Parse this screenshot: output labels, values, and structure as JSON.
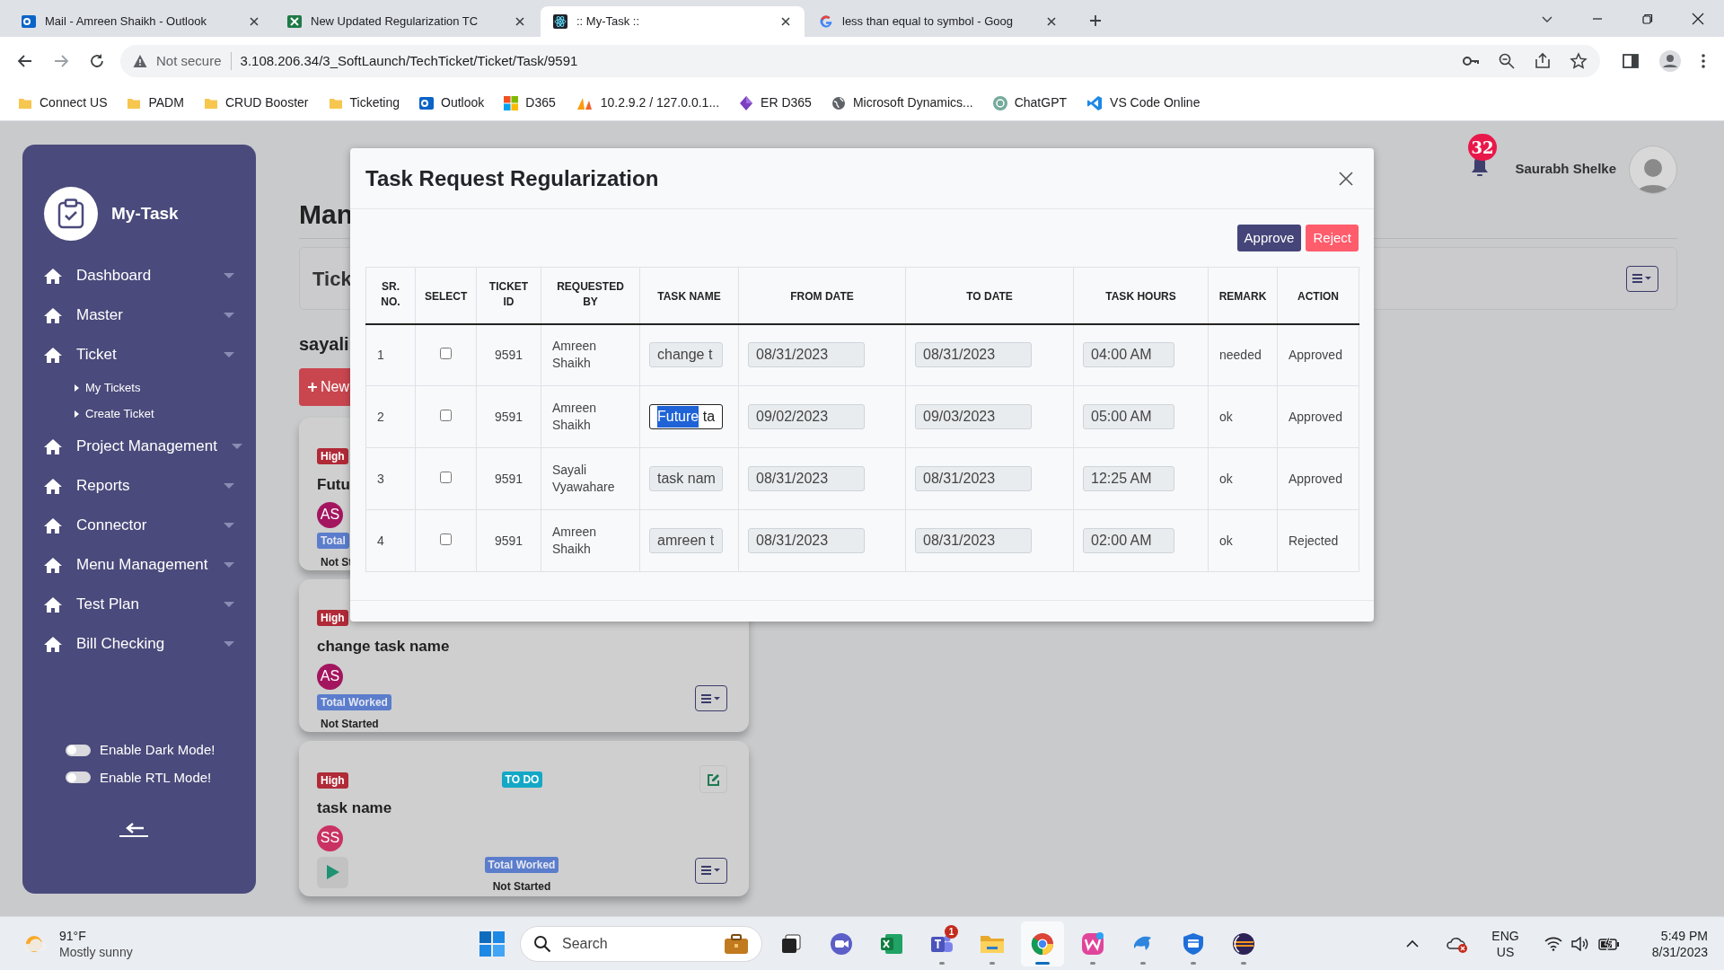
{
  "browser": {
    "tabs": [
      {
        "kind": "outlook",
        "title": "Mail - Amreen Shaikh - Outlook",
        "selected": false
      },
      {
        "kind": "excel",
        "title": "New Updated Regularization TC",
        "selected": false
      },
      {
        "kind": "react",
        "title": ":: My-Task ::",
        "selected": true
      },
      {
        "kind": "google",
        "title": "less than equal to symbol - Goog",
        "selected": false
      }
    ],
    "address_bar": {
      "security": "Not secure",
      "url": "3.108.206.34/3_SoftLaunch/TechTicket/Ticket/Task/9591"
    },
    "bookmarks": [
      {
        "kind": "folder",
        "label": "Connect US"
      },
      {
        "kind": "folder",
        "label": "PADM"
      },
      {
        "kind": "folder",
        "label": "CRUD Booster"
      },
      {
        "kind": "folder",
        "label": "Ticketing"
      },
      {
        "kind": "outlook",
        "label": "Outlook"
      },
      {
        "kind": "windows",
        "label": "D365"
      },
      {
        "kind": "pma",
        "label": "10.2.9.2 / 127.0.0.1..."
      },
      {
        "kind": "diamond",
        "label": "ER D365"
      },
      {
        "kind": "globe",
        "label": "Microsoft Dynamics..."
      },
      {
        "kind": "chatgpt",
        "label": "ChatGPT"
      },
      {
        "kind": "vscode",
        "label": "VS Code Online"
      }
    ]
  },
  "sidebar": {
    "app_name": "My-Task",
    "menu": [
      {
        "label": "Dashboard"
      },
      {
        "label": "Master"
      },
      {
        "label": "Ticket",
        "children": [
          {
            "label": "My Tickets"
          },
          {
            "label": "Create Ticket"
          }
        ]
      },
      {
        "label": "Project Management"
      },
      {
        "label": "Reports"
      },
      {
        "label": "Connector"
      },
      {
        "label": "Menu Management"
      },
      {
        "label": "Test Plan"
      },
      {
        "label": "Bill Checking"
      }
    ],
    "toggles": [
      {
        "label": "Enable Dark Mode!",
        "on": false
      },
      {
        "label": "Enable RTL Mode!",
        "on": false
      }
    ]
  },
  "header": {
    "notifications": "32",
    "user_name": "Saurabh Shelke"
  },
  "page": {
    "heading": "Man",
    "filter_card": {
      "label": "Tick"
    },
    "section": "sayali",
    "new_button": "New",
    "cards": [
      {
        "kind": "partial",
        "priority": "High",
        "title": "Futu",
        "initials": "AS",
        "color": "#a3165f",
        "total_label": "Total",
        "time": "Not St"
      },
      {
        "kind": "task",
        "priority": "High",
        "title": "change task name",
        "initials": "AS",
        "color": "#a3165f",
        "total_label": "Total Worked",
        "time": "Not Started"
      },
      {
        "kind": "todo",
        "priority": "High",
        "status": "TO DO",
        "title": "task name",
        "initials": "SS",
        "color": "#c93263",
        "total_label": "Total Worked",
        "time": "Not Started"
      }
    ]
  },
  "modal": {
    "title": "Task Request Regularization",
    "buttons": [
      {
        "kind": "approve",
        "label": "Approve"
      },
      {
        "kind": "reject",
        "label": "Reject"
      }
    ],
    "columns": [
      "SR. NO.",
      "SELECT",
      "TICKET ID",
      "REQUESTED BY",
      "TASK NAME",
      "FROM DATE",
      "TO DATE",
      "TASK HOURS",
      "REMARK",
      "ACTION"
    ],
    "rows": [
      {
        "sr": "1",
        "checked": false,
        "ticket_id": "9591",
        "requested_by": "Amreen Shaikh",
        "task_name": "change t",
        "focused": false,
        "from_date": "08/31/2023",
        "to_date": "08/31/2023",
        "task_hours": "04:00 AM",
        "remark": "needed",
        "action": "Approved"
      },
      {
        "sr": "2",
        "checked": false,
        "ticket_id": "9591",
        "requested_by": "Amreen Shaikh",
        "task_name": "Future ta",
        "focused": true,
        "from_date": "09/02/2023",
        "to_date": "09/03/2023",
        "task_hours": "05:00 AM",
        "remark": "ok",
        "action": "Approved"
      },
      {
        "sr": "3",
        "checked": false,
        "ticket_id": "9591",
        "requested_by": "Sayali Vyawahare",
        "task_name": "task nam",
        "focused": false,
        "from_date": "08/31/2023",
        "to_date": "08/31/2023",
        "task_hours": "12:25 AM",
        "remark": "ok",
        "action": "Approved"
      },
      {
        "sr": "4",
        "checked": false,
        "ticket_id": "9591",
        "requested_by": "Amreen Shaikh",
        "task_name": "amreen t",
        "focused": false,
        "from_date": "08/31/2023",
        "to_date": "08/31/2023",
        "task_hours": "02:00 AM",
        "remark": "ok",
        "action": "Rejected"
      }
    ]
  },
  "taskbar": {
    "weather": {
      "temperature": "91°F",
      "condition": "Mostly sunny"
    },
    "search": {
      "placeholder": "Search"
    },
    "apps": [
      {
        "kind": "taskview",
        "open": false,
        "active": false
      },
      {
        "kind": "meet",
        "open": false,
        "active": false
      },
      {
        "kind": "excel",
        "open": false,
        "active": false
      },
      {
        "kind": "teams",
        "open": true,
        "active": false,
        "badge": "1"
      },
      {
        "kind": "files",
        "open": true,
        "active": false
      },
      {
        "kind": "chrome",
        "open": true,
        "active": true
      },
      {
        "kind": "wps",
        "open": true,
        "active": false
      },
      {
        "kind": "dolphin",
        "open": true,
        "active": false
      },
      {
        "kind": "shield",
        "open": true,
        "active": false
      },
      {
        "kind": "eclipse",
        "open": true,
        "active": false
      }
    ],
    "tray": {
      "language": "ENG",
      "region": "US",
      "time": "5:49 PM",
      "date": "8/31/2023"
    }
  }
}
